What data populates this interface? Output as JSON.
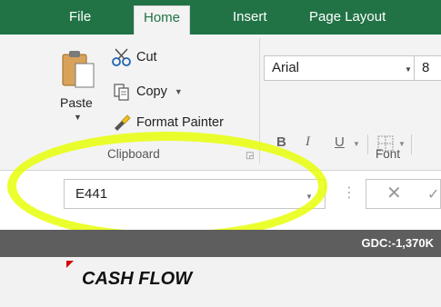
{
  "ribbon_tabs": [
    {
      "label": "File"
    },
    {
      "label": "Home"
    },
    {
      "label": "Insert"
    },
    {
      "label": "Page Layout"
    }
  ],
  "clipboard": {
    "paste_label": "Paste",
    "cut_label": "Cut",
    "copy_label": "Copy",
    "format_painter_label": "Format Painter",
    "group_label": "Clipboard"
  },
  "font": {
    "font_name": "Arial",
    "font_size": "8",
    "bold": "B",
    "italic": "I",
    "underline": "U",
    "group_label": "Font"
  },
  "formula_bar": {
    "name_box_value": "E441",
    "cancel_symbol": "✕",
    "enter_symbol": "✓"
  },
  "sheet": {
    "gdc_text": "GDC:-1,370K",
    "cashflow_title": "CASH FLOW"
  },
  "colors": {
    "ribbon_green": "#217346",
    "highlight": "#e8ff00",
    "header_row": "#5e5e5e"
  }
}
